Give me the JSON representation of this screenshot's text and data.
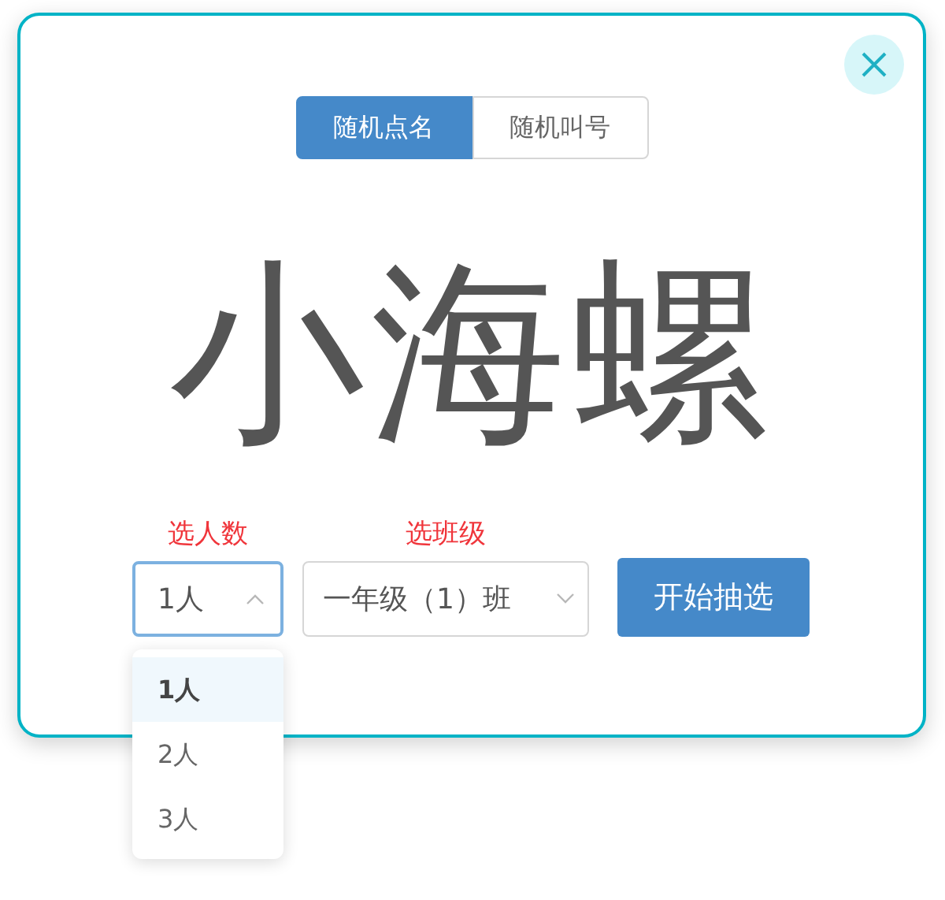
{
  "tabs": [
    {
      "label": "随机点名",
      "selected": true
    },
    {
      "label": "随机叫号",
      "selected": false
    }
  ],
  "result": {
    "name": "小海螺"
  },
  "count_select": {
    "label": "选人数",
    "value": "1人",
    "open": true,
    "options": [
      {
        "label": "1人",
        "selected": true
      },
      {
        "label": "2人",
        "selected": false
      },
      {
        "label": "3人",
        "selected": false
      }
    ]
  },
  "class_select": {
    "label": "选班级",
    "value": "一年级（1）班",
    "open": false
  },
  "start_button": {
    "label": "开始抽选"
  }
}
